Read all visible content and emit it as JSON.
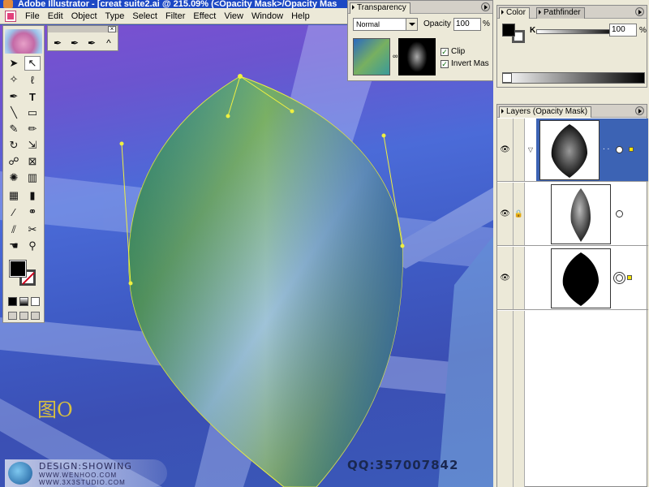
{
  "window": {
    "title": "Adobe Illustrator - [creat suite2.ai @ 215.09% (<Opacity Mask>/Opacity Mas"
  },
  "menu": [
    "File",
    "Edit",
    "Object",
    "Type",
    "Select",
    "Filter",
    "Effect",
    "View",
    "Window",
    "Help"
  ],
  "transparency": {
    "tab": "Transparency",
    "blend_mode": "Normal",
    "opacity_label": "Opacity",
    "opacity_value": "100",
    "opacity_unit": "%",
    "clip_label": "Clip",
    "clip_checked": true,
    "invert_label": "Invert Mas",
    "invert_checked": true
  },
  "color": {
    "tab_color": "Color",
    "tab_pathfinder": "Pathfinder",
    "channel": "K",
    "value": "100",
    "unit": "%"
  },
  "layers": {
    "tab": "Layers (Opacity Mask)",
    "rows": [
      {
        "visible": true,
        "locked": false,
        "expanded": true,
        "selected": true
      },
      {
        "visible": true,
        "locked": true,
        "expanded": false,
        "selected": false
      },
      {
        "visible": true,
        "locked": false,
        "expanded": false,
        "selected": true
      }
    ]
  },
  "canvas": {
    "figure_label": "图O",
    "qq": "QQ:357007842"
  },
  "watermark": {
    "line1": "DESIGN:SHOWING",
    "line2": "WWW.WENHOO.COM",
    "line3": "WWW.3X3STUDIO.COM"
  },
  "colors": {
    "titlebar": "#1c48c4",
    "panel_bg": "#ece9d8",
    "anchor_handle": "#f0f040",
    "layer_selected": "#3c63b4"
  },
  "icons": [
    "selection-icon",
    "direct-selection-icon",
    "magic-wand-icon",
    "lasso-icon",
    "pen-icon",
    "type-icon",
    "line-icon",
    "rectangle-icon",
    "paintbrush-icon",
    "pencil-icon",
    "rotate-icon",
    "scale-icon",
    "warp-icon",
    "free-transform-icon",
    "symbol-sprayer-icon",
    "graph-icon",
    "mesh-icon",
    "gradient-icon",
    "eyedropper-icon",
    "blend-icon",
    "slice-icon",
    "scissors-icon",
    "hand-icon",
    "zoom-icon"
  ]
}
